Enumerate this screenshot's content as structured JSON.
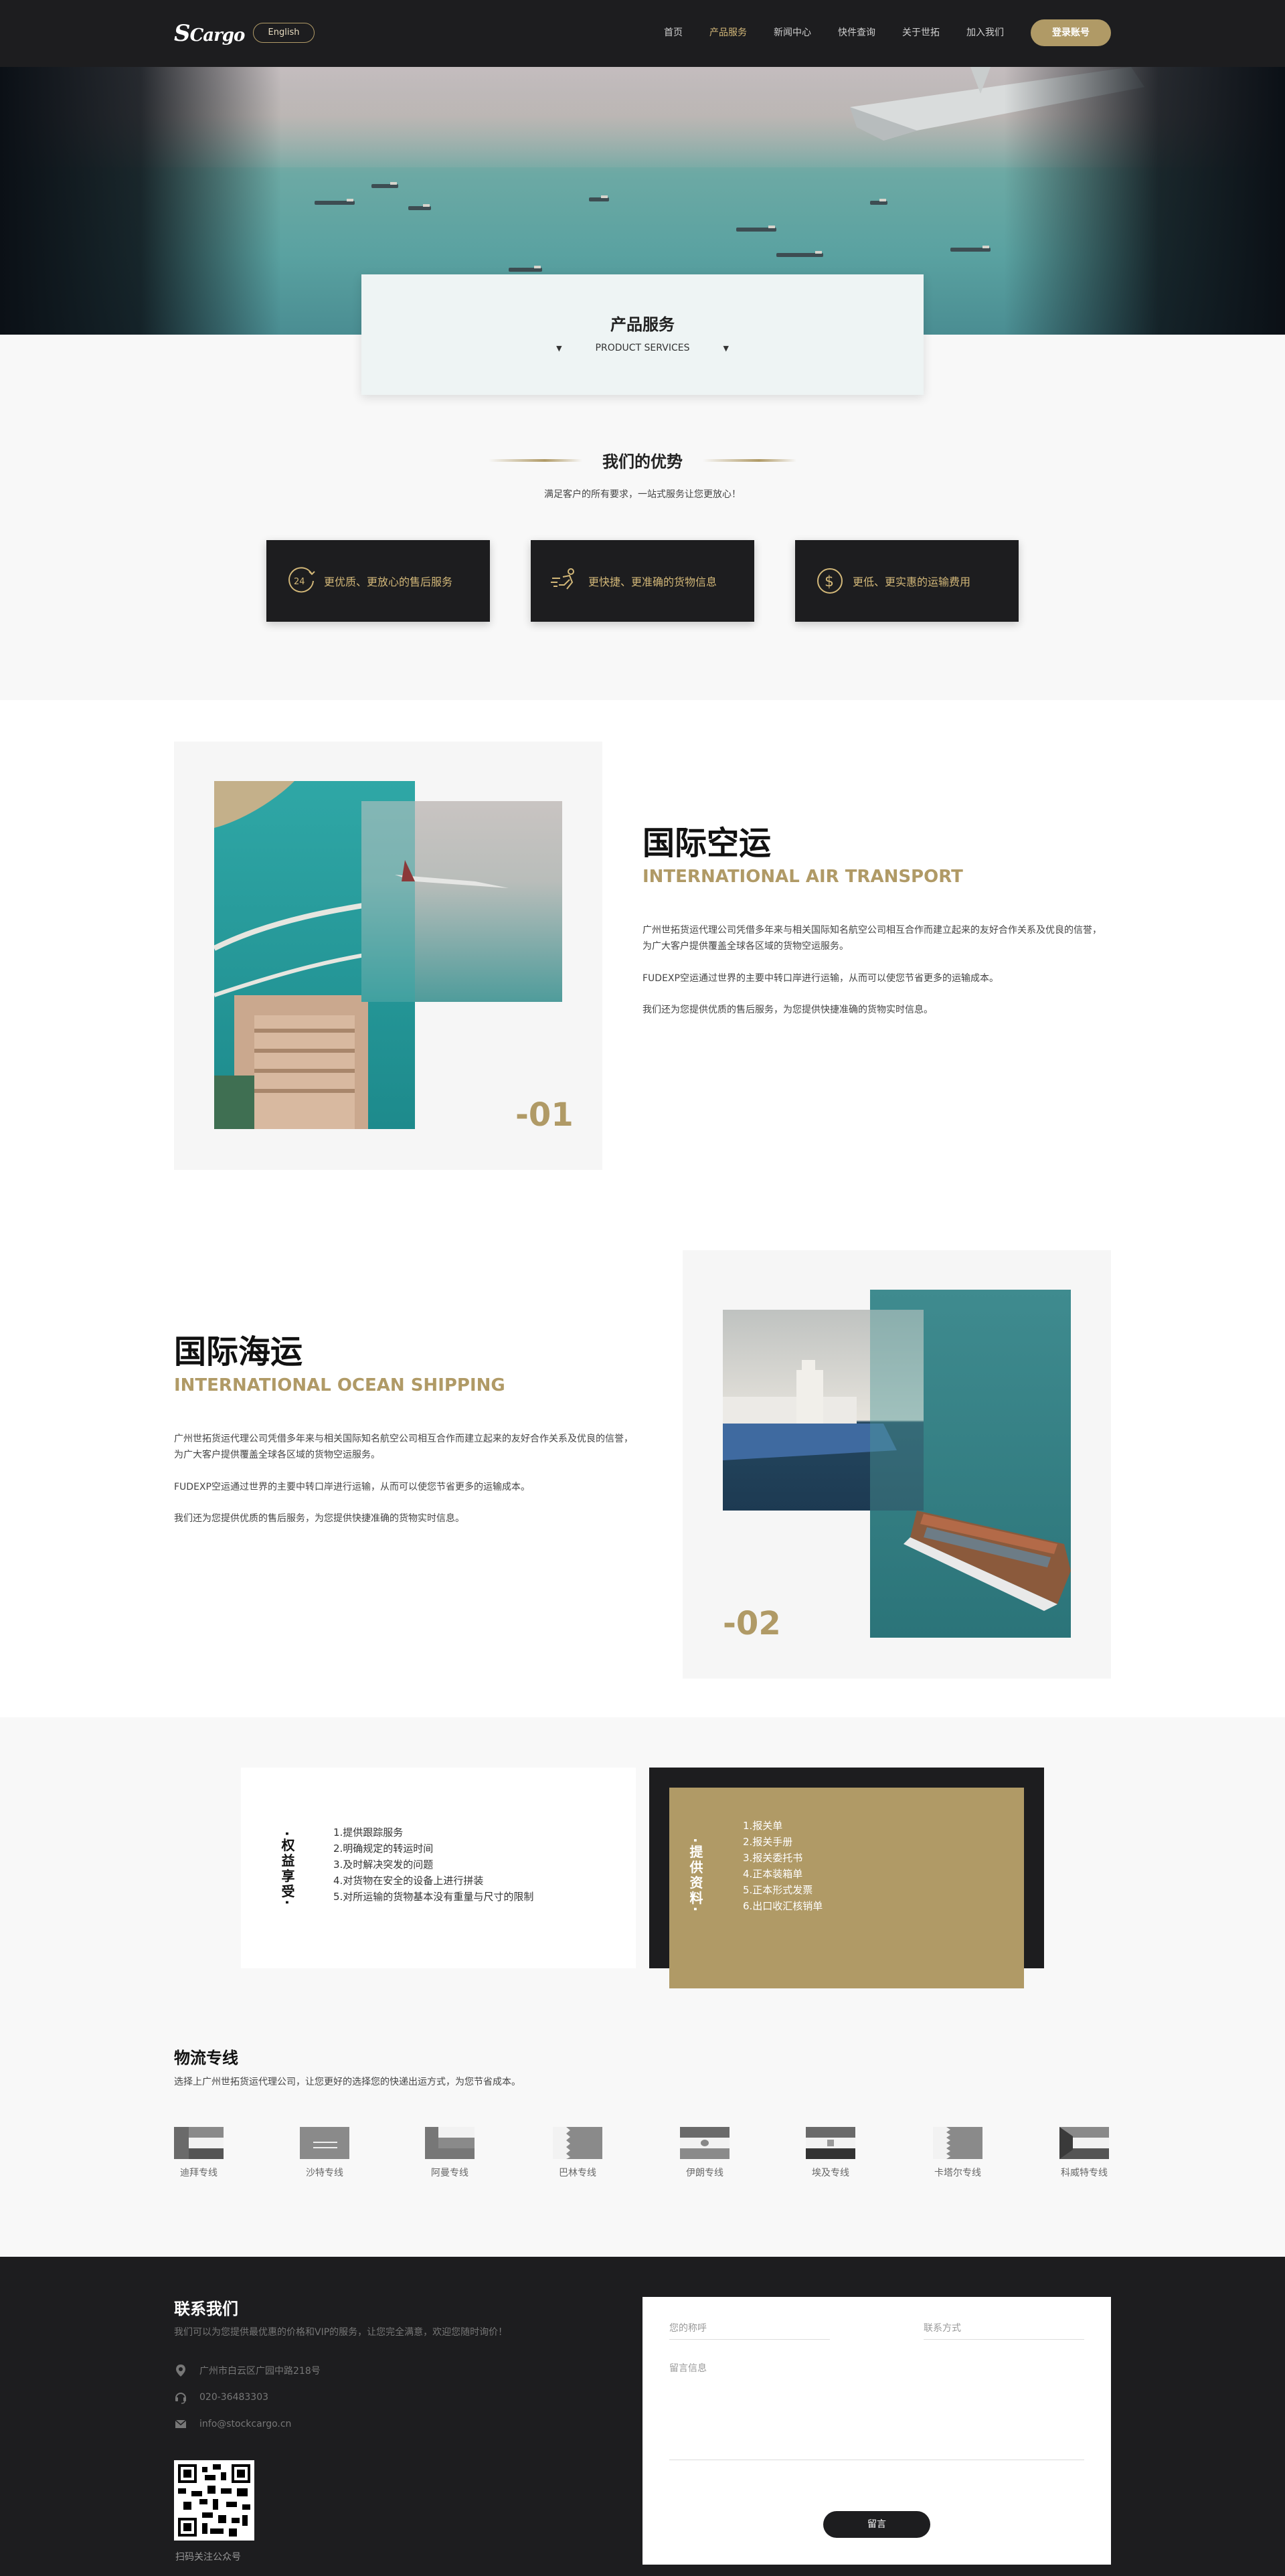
{
  "nav": {
    "logo_initial": "S",
    "logo_rest": "Cargo",
    "lang_label": "English",
    "items": [
      {
        "label": "首页",
        "active": false
      },
      {
        "label": "产品服务",
        "active": true
      },
      {
        "label": "新闻中心",
        "active": false
      },
      {
        "label": "快件查询",
        "active": false
      },
      {
        "label": "关于世拓",
        "active": false
      },
      {
        "label": "加入我们",
        "active": false
      }
    ],
    "login_label": "登录账号"
  },
  "hero": {
    "title": "产品服务",
    "subtitle": "PRODUCT SERVICES",
    "arrow": "▼"
  },
  "advantages": {
    "title": "我们的优势",
    "subtitle": "满足客户的所有要求，一站式服务让您更放心！",
    "items": [
      {
        "icon": "clock-24-icon",
        "label": "更优质、更放心的售后服务"
      },
      {
        "icon": "fast-delivery-icon",
        "label": "更快捷、更准确的货物信息"
      },
      {
        "icon": "dollar-coin-icon",
        "label": "更低、更实惠的运输费用"
      }
    ]
  },
  "air": {
    "number": "-01",
    "title": "国际空运",
    "subtitle": "INTERNATIONAL AIR TRANSPORT",
    "p1": "广州世拓货运代理公司凭借多年来与相关国际知名航空公司相互合作而建立起来的友好合作关系及优良的信誉，为广大客户提供覆盖全球各区域的货物空运服务。",
    "p2": "FUDEXP空运通过世界的主要中转口岸进行运输，从而可以使您节省更多的运输成本。",
    "p3": "我们还为您提供优质的售后服务，为您提供快捷准确的货物实时信息。"
  },
  "ocean": {
    "number": "-02",
    "title": "国际海运",
    "subtitle": "INTERNATIONAL OCEAN SHIPPING",
    "p1": "广州世拓货运代理公司凭借多年来与相关国际知名航空公司相互合作而建立起来的友好合作关系及优良的信誉，为广大客户提供覆盖全球各区域的货物空运服务。",
    "p2": "FUDEXP空运通过世界的主要中转口岸进行运输，从而可以使您节省更多的运输成本。",
    "p3": "我们还为您提供优质的售后服务，为您提供快捷准确的货物实时信息。"
  },
  "benefits": {
    "left_title": "·权益享受·",
    "left_items": [
      "1.提供跟踪服务",
      "2.明确规定的转运时间",
      "3.及时解决突发的问题",
      "4.对货物在安全的设备上进行拼装",
      "5.对所运输的货物基本没有重量与尺寸的限制"
    ],
    "right_title": "·提供资料·",
    "right_items": [
      "1.报关单",
      "2.报关手册",
      "3.报关委托书",
      "4.正本装箱单",
      "5.正本形式发票",
      "6.出口收汇核销单"
    ]
  },
  "logistics": {
    "title": "物流专线",
    "subtitle": "选择上广州世拓货运代理公司，让您更好的选择您的快递出运方式，为您节省成本。",
    "lines": [
      {
        "label": "迪拜专线",
        "flag": "uae-flag-icon"
      },
      {
        "label": "沙特专线",
        "flag": "saudi-flag-icon"
      },
      {
        "label": "阿曼专线",
        "flag": "oman-flag-icon"
      },
      {
        "label": "巴林专线",
        "flag": "bahrain-flag-icon"
      },
      {
        "label": "伊朗专线",
        "flag": "iran-flag-icon"
      },
      {
        "label": "埃及专线",
        "flag": "egypt-flag-icon"
      },
      {
        "label": "卡塔尔专线",
        "flag": "qatar-flag-icon"
      },
      {
        "label": "科威特专线",
        "flag": "kuwait-flag-icon"
      }
    ]
  },
  "footer": {
    "title": "联系我们",
    "desc": "我们可以为您提供最优惠的价格和VIP的服务，让您完全满意，欢迎您随时询价！",
    "address": "广州市白云区广园中路218号",
    "phone": "020-36483303",
    "email": "info@stockcargo.cn",
    "qr_label": "扫码关注公众号",
    "form": {
      "name_placeholder": "您的称呼",
      "contact_placeholder": "联系方式",
      "message_placeholder": "留言信息",
      "submit_label": "留言"
    }
  }
}
